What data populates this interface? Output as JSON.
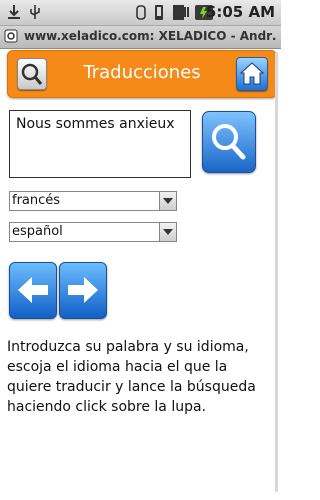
{
  "status_bar": {
    "time": "5:05 AM",
    "icons": [
      "download-icon",
      "usb-icon",
      "debug-icon",
      "vibrate-icon",
      "no-sim-icon",
      "signal-icon",
      "battery-icon"
    ]
  },
  "browser": {
    "url_title": "www.xeladico.com: XELADICO - Andr…"
  },
  "header": {
    "title": "Traducciones",
    "accent": "#f58a18"
  },
  "translate": {
    "input_value": "Nous sommes anxieux",
    "source_language": "francés",
    "target_language": "español"
  },
  "instructions": "Introduzca su palabra y su idioma, escoja el idioma hacia el que la quiere traducir y lance la búsqueda haciendo click sobre la lupa."
}
